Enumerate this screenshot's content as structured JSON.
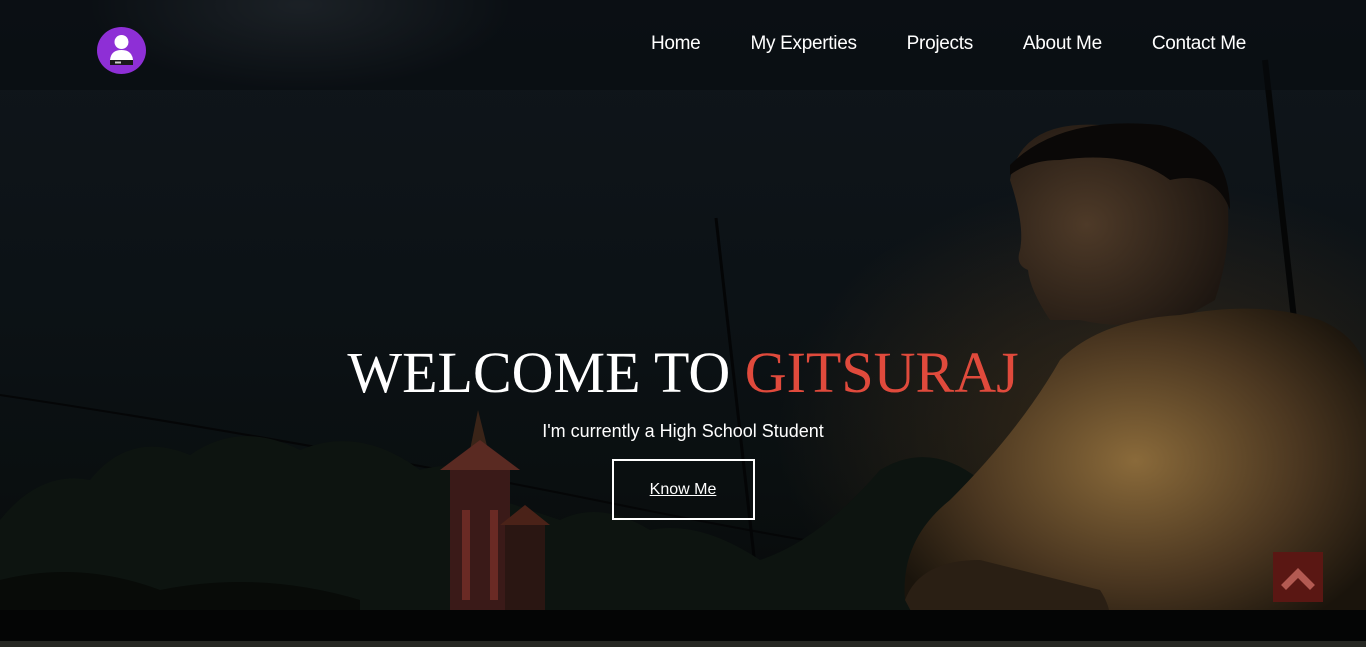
{
  "site": {
    "logo_icon": "person-silhouette-icon",
    "accent_color": "#e04a3c",
    "logo_bg_color": "#8e2fd6"
  },
  "nav": {
    "items": [
      {
        "label": "Home"
      },
      {
        "label": "My Experties"
      },
      {
        "label": "Projects"
      },
      {
        "label": "About Me"
      },
      {
        "label": "Contact Me"
      }
    ]
  },
  "hero": {
    "title_prefix": "WELCOME TO ",
    "title_highlight": "GITSURAJ",
    "subtitle": "I'm currently a High School Student",
    "button_label": "Know Me"
  },
  "scroll_top": {
    "icon": "chevron-up-icon",
    "bg_color": "#5a1713"
  }
}
